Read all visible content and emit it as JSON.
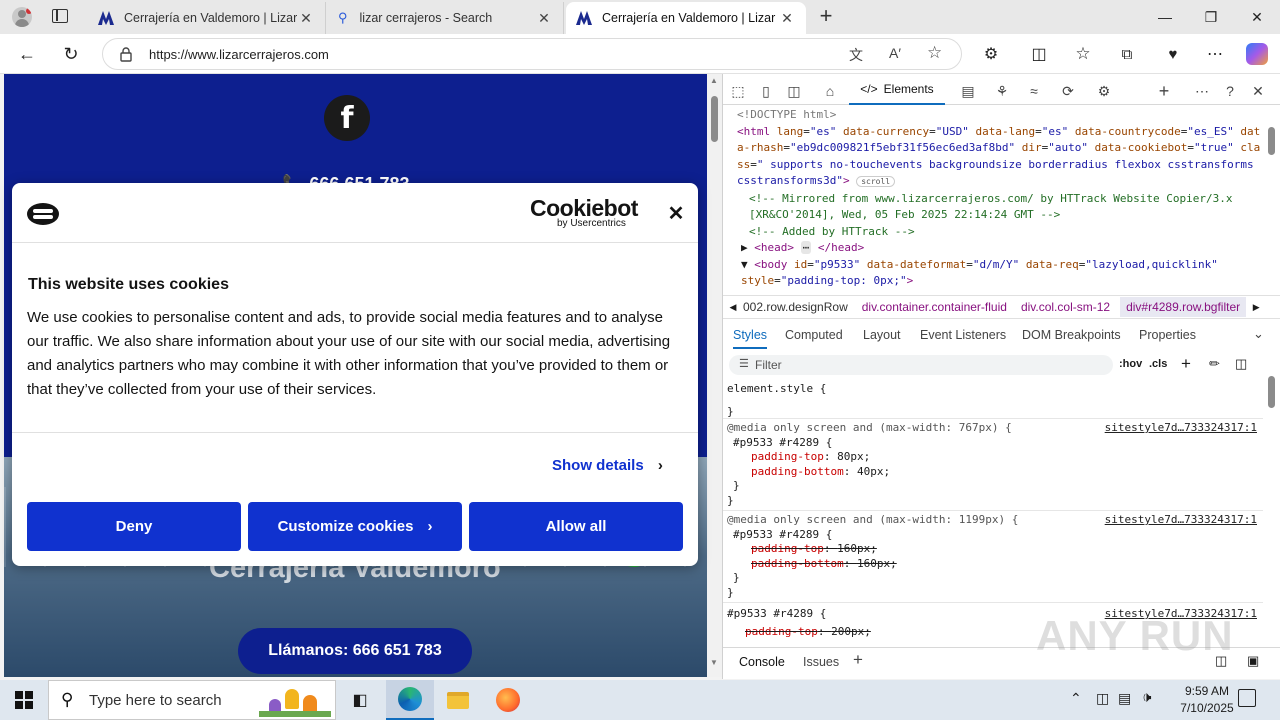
{
  "browser": {
    "tabs": [
      {
        "label": "Cerrajería en Valdemoro | Lizar Ce",
        "close": "✕",
        "active": false
      },
      {
        "label": "lizar cerrajeros - Search",
        "close": "✕",
        "active": false
      },
      {
        "label": "Cerrajería en Valdemoro | Lizar Ce",
        "close": "✕",
        "active": true
      }
    ],
    "new_tab": "+",
    "url": "https://www.lizarcerrajeros.com"
  },
  "page": {
    "facebook_letter": "f",
    "phone_partial": "📞 666 651 783",
    "hero_title": "Cerrajería Valdemoro",
    "call_button": "Llámanos: 666 651 783"
  },
  "cookie": {
    "brand": "Cookiebot",
    "brand_sub": "by Usercentrics",
    "close": "✕",
    "title": "This website uses cookies",
    "body": "We use cookies to personalise content and ads, to provide social media features and to analyse our traffic. We also share information about your use of our site with our social media, advertising and analytics partners who may combine it with other information that you’ve provided to them or that they’ve collected from your use of their services.",
    "show_details": "Show details",
    "deny": "Deny",
    "customize": "Customize cookies",
    "allow_all": "Allow all"
  },
  "devtools": {
    "elements_tab": "Elements",
    "dom": {
      "doctype": "<!DOCTYPE html>",
      "html_open": "<html",
      "html_attrs": [
        {
          "name": "lang",
          "value": "\"es\""
        },
        {
          "name": "data-currency",
          "value": "\"USD\""
        },
        {
          "name": "data-lang",
          "value": "\"es\""
        },
        {
          "name": "data-countrycode",
          "value": "\"es_ES\""
        },
        {
          "name": "data-rhash",
          "value": "\"eb9dc009821f5ebf31f56ec6ed3af8bd\""
        },
        {
          "name": "dir",
          "value": "\"auto\""
        },
        {
          "name": "data-cookiebot",
          "value": "\"true\""
        },
        {
          "name": "class",
          "value": "\" supports no-touchevents backgroundsize borderradius flexbox csstransforms csstransforms3d\""
        }
      ],
      "scroll_badge": "scroll",
      "comment1": "<!-- Mirrored from www.lizarcerrajeros.com/ by HTTrack Website Copier/3.x [XR&CO'2014], Wed, 05 Feb 2025 22:14:24 GMT -->",
      "comment2": "<!-- Added by HTTrack -->",
      "head": "<head>",
      "head_ellipsis": "⋯",
      "head_close": "</head>",
      "body_open": "<body",
      "body_attrs": [
        {
          "name": "id",
          "value": "\"p9533\""
        },
        {
          "name": "data-dateformat",
          "value": "\"d/m/Y\""
        },
        {
          "name": "data-req",
          "value": "\"lazyload,quicklink\""
        },
        {
          "name": "style",
          "value": "\"padding-top: 0px;\""
        }
      ]
    },
    "breadcrumbs": [
      "002.row.designRow",
      "div.container.container-fluid",
      "div.col.col-sm-12",
      "div#r4289.row.bgfilter"
    ],
    "style_tabs": [
      "Styles",
      "Computed",
      "Layout",
      "Event Listeners",
      "DOM Breakpoints",
      "Properties"
    ],
    "filter_placeholder": "Filter",
    "hov": ":hov",
    "cls": ".cls",
    "rules": [
      {
        "selector": "element.style {",
        "close": "}",
        "media": "",
        "source": "",
        "props": []
      },
      {
        "media": "@media only screen and (max-width: 767px) {",
        "selector": "#p9533 #r4289 {",
        "source": "sitestyle7d…733324317:1",
        "close": "}",
        "props": [
          {
            "name": "padding-top",
            "value": "80px;",
            "struck": false
          },
          {
            "name": "padding-bottom",
            "value": "40px;",
            "struck": false
          }
        ]
      },
      {
        "media": "@media only screen and (max-width: 1199px) {",
        "selector": "#p9533 #r4289 {",
        "source": "sitestyle7d…733324317:1",
        "close": "}",
        "props": [
          {
            "name": "padding-top",
            "value": "160px;",
            "struck": true
          },
          {
            "name": "padding-bottom",
            "value": "160px;",
            "struck": true
          }
        ]
      },
      {
        "media": "",
        "selector": "#p9533 #r4289 {",
        "source": "sitestyle7d…733324317:1",
        "close": "",
        "props": [
          {
            "name": "padding-top",
            "value": "200px;",
            "struck": true
          }
        ]
      }
    ],
    "drawer_tabs": [
      "Console",
      "Issues"
    ]
  },
  "taskbar": {
    "search_placeholder": "Type here to search",
    "time": "9:59 AM",
    "date": "7/10/2025"
  },
  "watermark": "ANY RUN"
}
